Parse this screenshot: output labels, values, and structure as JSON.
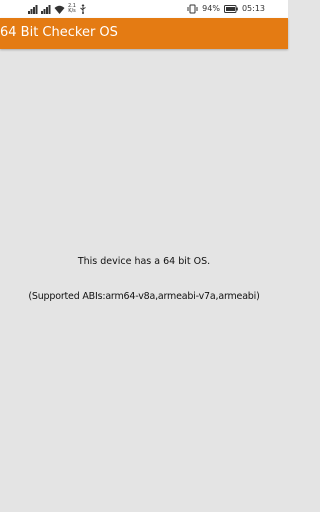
{
  "status_bar": {
    "network_speed_value": "2.1",
    "network_speed_unit": "K/s",
    "battery_percent": "94%",
    "time": "05:13",
    "icons": [
      "signal-icon",
      "signal-icon",
      "wifi-icon",
      "usb-icon",
      "vibrate-icon",
      "battery-icon"
    ]
  },
  "app_bar": {
    "title": "64 Bit Checker OS",
    "color": "#e47b13"
  },
  "content": {
    "message": "This device has a 64 bit OS.",
    "abis": "(Supported ABIs:arm64-v8a,armeabi-v7a,armeabi)"
  }
}
